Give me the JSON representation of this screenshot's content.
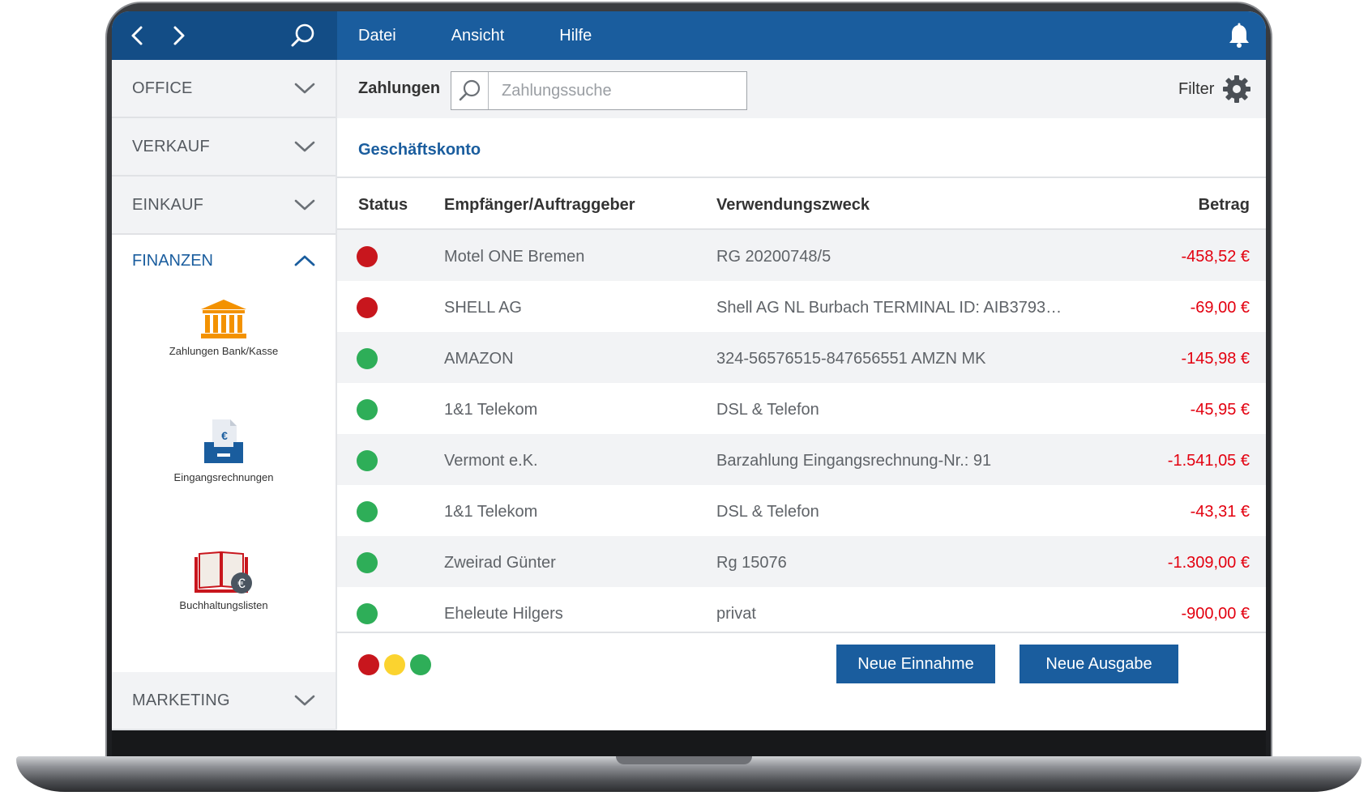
{
  "topbar": {
    "menu": [
      "Datei",
      "Ansicht",
      "Hilfe"
    ],
    "icons": {
      "back": "chevron-left-icon",
      "forward": "chevron-right-icon",
      "search": "search-icon",
      "notifications": "bell-icon"
    }
  },
  "sidebar": {
    "sections": [
      {
        "label": "OFFICE",
        "expanded": false
      },
      {
        "label": "VERKAUF",
        "expanded": false
      },
      {
        "label": "EINKAUF",
        "expanded": false
      },
      {
        "label": "FINANZEN",
        "expanded": true
      },
      {
        "label": "MARKETING",
        "expanded": false
      }
    ],
    "finance_apps": [
      {
        "label": "Zahlungen Bank/Kasse",
        "icon": "bank-icon"
      },
      {
        "label": "Eingangsrechnungen",
        "icon": "incoming-invoice-icon"
      },
      {
        "label": "Buchhaltungslisten",
        "icon": "accounting-book-icon"
      }
    ]
  },
  "main": {
    "title": "Zahlungen",
    "search_placeholder": "Zahlungssuche",
    "filter_label": "Filter",
    "account": "Geschäftskonto",
    "columns": {
      "status": "Status",
      "recipient": "Empfänger/Auftraggeber",
      "purpose": "Verwendungszweck",
      "amount": "Betrag"
    },
    "rows": [
      {
        "status": "red",
        "recipient": "Motel ONE Bremen",
        "purpose": "RG 20200748/5",
        "amount": "-458,52 €"
      },
      {
        "status": "red",
        "recipient": "SHELL AG",
        "purpose": "Shell AG NL Burbach TERMINAL ID: AIB3793…",
        "amount": "-69,00 €"
      },
      {
        "status": "green",
        "recipient": "AMAZON",
        "purpose": "324-56576515-847656551 AMZN MK",
        "amount": "-145,98 €"
      },
      {
        "status": "green",
        "recipient": "1&1 Telekom",
        "purpose": "DSL & Telefon",
        "amount": "-45,95 €"
      },
      {
        "status": "green",
        "recipient": "Vermont e.K.",
        "purpose": "Barzahlung Eingangsrechnung-Nr.: 91",
        "amount": "-1.541,05 €"
      },
      {
        "status": "green",
        "recipient": "1&1 Telekom",
        "purpose": "DSL & Telefon",
        "amount": "-43,31 €"
      },
      {
        "status": "green",
        "recipient": "Zweirad Günter",
        "purpose": "Rg 15076",
        "amount": "-1.309,00 €"
      },
      {
        "status": "green",
        "recipient": "Eheleute Hilgers",
        "purpose": "privat",
        "amount": "-900,00 €"
      }
    ],
    "legend": [
      "red",
      "yellow",
      "green"
    ],
    "buttons": {
      "income": "Neue Einnahme",
      "expense": "Neue Ausgabe"
    }
  },
  "colors": {
    "brand_blue": "#1a5d9e",
    "status_red": "#c8161d",
    "status_yellow": "#fbd32f",
    "status_green": "#2eae58",
    "amount_negative": "#e3000f"
  }
}
